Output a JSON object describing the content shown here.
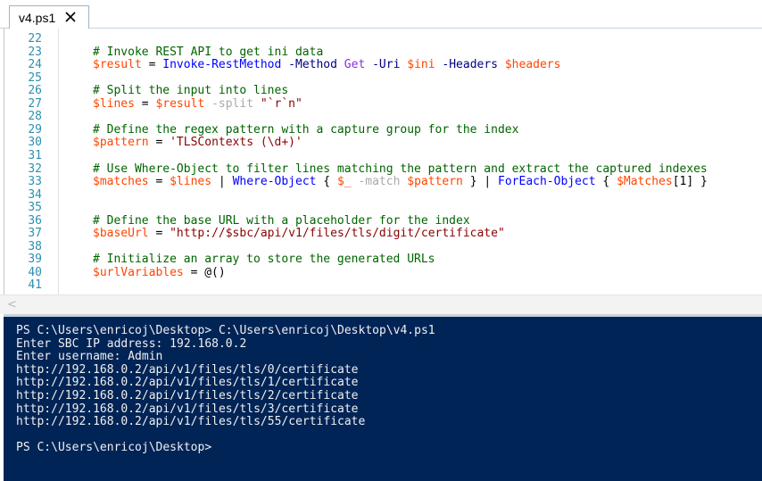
{
  "tab": {
    "label": "v4.ps1",
    "close_icon": "close-icon"
  },
  "editor": {
    "lines": [
      {
        "n": "22",
        "parts": []
      },
      {
        "n": "23",
        "parts": [
          {
            "t": "# Invoke REST API to get ini data",
            "c": "comment"
          }
        ]
      },
      {
        "n": "24",
        "parts": [
          {
            "t": "$result",
            "c": "var"
          },
          {
            "t": " = ",
            "c": "plain"
          },
          {
            "t": "Invoke-RestMethod",
            "c": "cmd"
          },
          {
            "t": " -Method ",
            "c": "param"
          },
          {
            "t": "Get",
            "c": "cmdarg"
          },
          {
            "t": " -Uri ",
            "c": "param"
          },
          {
            "t": "$ini",
            "c": "var"
          },
          {
            "t": " -Headers ",
            "c": "param"
          },
          {
            "t": "$headers",
            "c": "var"
          }
        ]
      },
      {
        "n": "25",
        "parts": []
      },
      {
        "n": "26",
        "parts": [
          {
            "t": "# Split the input into lines",
            "c": "comment"
          }
        ]
      },
      {
        "n": "27",
        "parts": [
          {
            "t": "$lines",
            "c": "var"
          },
          {
            "t": " = ",
            "c": "plain"
          },
          {
            "t": "$result",
            "c": "var"
          },
          {
            "t": " -split ",
            "c": "op"
          },
          {
            "t": "\"`r`n\"",
            "c": "str"
          }
        ]
      },
      {
        "n": "28",
        "parts": []
      },
      {
        "n": "29",
        "parts": [
          {
            "t": "# Define the regex pattern with a capture group for the index",
            "c": "comment"
          }
        ]
      },
      {
        "n": "30",
        "parts": [
          {
            "t": "$pattern",
            "c": "var"
          },
          {
            "t": " = ",
            "c": "plain"
          },
          {
            "t": "'TLSContexts (\\d+)'",
            "c": "str"
          }
        ]
      },
      {
        "n": "31",
        "parts": []
      },
      {
        "n": "32",
        "parts": [
          {
            "t": "# Use Where-Object to filter lines matching the pattern and extract the captured indexes",
            "c": "comment"
          }
        ]
      },
      {
        "n": "33",
        "parts": [
          {
            "t": "$matches",
            "c": "var"
          },
          {
            "t": " = ",
            "c": "plain"
          },
          {
            "t": "$lines",
            "c": "var"
          },
          {
            "t": " | ",
            "c": "plain"
          },
          {
            "t": "Where-Object",
            "c": "cmd"
          },
          {
            "t": " { ",
            "c": "plain"
          },
          {
            "t": "$_",
            "c": "var"
          },
          {
            "t": " -match ",
            "c": "op"
          },
          {
            "t": "$pattern",
            "c": "var"
          },
          {
            "t": " } | ",
            "c": "plain"
          },
          {
            "t": "ForEach-Object",
            "c": "cmd"
          },
          {
            "t": " { ",
            "c": "plain"
          },
          {
            "t": "$Matches",
            "c": "var"
          },
          {
            "t": "[1] }",
            "c": "plain"
          }
        ]
      },
      {
        "n": "34",
        "parts": []
      },
      {
        "n": "35",
        "parts": []
      },
      {
        "n": "36",
        "parts": [
          {
            "t": "# Define the base URL with a placeholder for the index",
            "c": "comment"
          }
        ]
      },
      {
        "n": "37",
        "parts": [
          {
            "t": "$baseUrl",
            "c": "var"
          },
          {
            "t": " = ",
            "c": "plain"
          },
          {
            "t": "\"http://$sbc/api/v1/files/tls/digit/certificate\"",
            "c": "str"
          }
        ]
      },
      {
        "n": "38",
        "parts": []
      },
      {
        "n": "39",
        "parts": [
          {
            "t": "# Initialize an array to store the generated URLs",
            "c": "comment"
          }
        ]
      },
      {
        "n": "40",
        "parts": [
          {
            "t": "$urlVariables",
            "c": "var"
          },
          {
            "t": " = @()",
            "c": "plain"
          }
        ]
      },
      {
        "n": "41",
        "parts": []
      }
    ]
  },
  "colors": {
    "comment": "#006400",
    "var": "#ff4500",
    "cmd": "#0000ff",
    "param": "#000080",
    "op": "#a9a9a9",
    "str": "#8b0000",
    "plain": "#000000",
    "cmdarg": "#8a2be2",
    "console_bg": "#012456",
    "line_number": "#2b91af"
  },
  "console": {
    "lines": [
      "PS C:\\Users\\enricoj\\Desktop> C:\\Users\\enricoj\\Desktop\\v4.ps1",
      "Enter SBC IP address: 192.168.0.2",
      "Enter username: Admin",
      "http://192.168.0.2/api/v1/files/tls/0/certificate",
      "http://192.168.0.2/api/v1/files/tls/1/certificate",
      "http://192.168.0.2/api/v1/files/tls/2/certificate",
      "http://192.168.0.2/api/v1/files/tls/3/certificate",
      "http://192.168.0.2/api/v1/files/tls/55/certificate",
      "",
      "PS C:\\Users\\enricoj\\Desktop>"
    ]
  },
  "scrollbar": {
    "left_arrow": "<"
  }
}
